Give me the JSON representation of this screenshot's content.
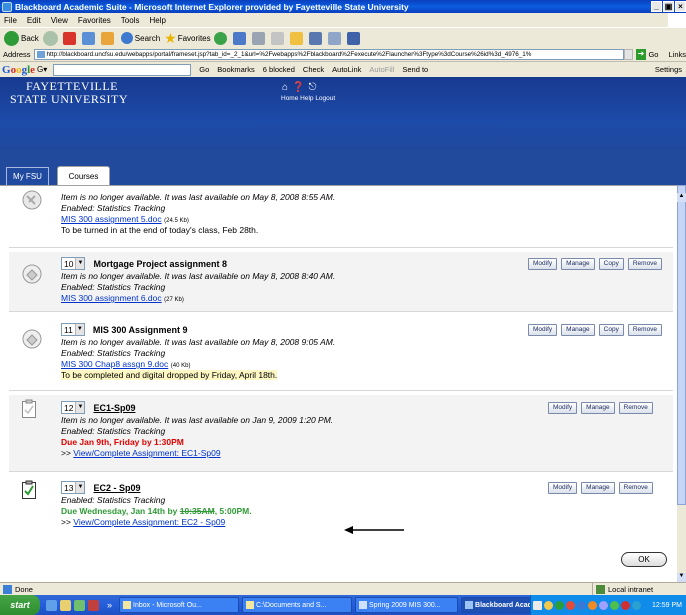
{
  "window": {
    "title": "Blackboard Academic Suite - Microsoft Internet Explorer provided by Fayetteville State University",
    "controls": [
      "_",
      "×"
    ]
  },
  "menu": [
    "File",
    "Edit",
    "View",
    "Favorites",
    "Tools",
    "Help"
  ],
  "toolbar": {
    "back": "Back",
    "search": "Search",
    "favorites": "Favorites"
  },
  "address": {
    "label": "Address",
    "url": "http://blackboard.uncfsu.edu/webapps/portal/frameset.jsp?tab_id=_2_1&url=%2Fwebapps%2Fblackboard%2Fexecute%2Flauncher%3Ftype%3dCourse%26id%3d_4976_1%",
    "go": "Go",
    "links": "Links"
  },
  "googlebar": {
    "go": "Go",
    "bookmarks": "Bookmarks",
    "blocked": "6 blocked",
    "check": "Check",
    "autolink": "AutoLink",
    "autofill": "AutoFill",
    "sendto": "Send to",
    "settings": "Settings"
  },
  "portal": {
    "university_line1": "Fayetteville",
    "university_line2": "State University",
    "nav_labels": "Home Help Logout",
    "tabs": {
      "myfsu": "My FSU",
      "courses": "Courses"
    }
  },
  "buttons": {
    "modify": "Modify",
    "manage": "Manage",
    "copy": "Copy",
    "remove": "Remove",
    "ok": "OK"
  },
  "items": [
    {
      "partial_title": "",
      "availability": "Item is no longer available. It was last available on May 8, 2008 8:55 AM.",
      "tracking": "Enabled: Statistics Tracking",
      "file": "MIS 300 assignment 5.doc",
      "size": "(24.5 Kb)",
      "note": "To be turned in at the end of today's class, Feb 28th."
    },
    {
      "number": "10",
      "title": "Mortgage Project assignment 8",
      "availability": "Item is no longer available. It was last available on May 8, 2008 8:40 AM.",
      "tracking": "Enabled: Statistics Tracking",
      "file": "MIS 300 assignment 6.doc",
      "size": "(27 Kb)"
    },
    {
      "number": "11",
      "title": "MIS 300 Assignment 9",
      "availability": "Item is no longer available. It was last available on May 8, 2008 9:05 AM.",
      "tracking": "Enabled: Statistics Tracking",
      "file": "MIS 300 Chap8 assgn 9.doc",
      "size": "(40 Kb)",
      "note": "To be completed and digital dropped by Friday, April 18th."
    },
    {
      "number": "12",
      "title": "EC1-Sp09",
      "availability": "Item is no longer available. It was last available on Jan 9, 2009 1:20 PM.",
      "tracking": "Enabled: Statistics Tracking",
      "due": "Due Jan 9th, Friday by 1:30PM",
      "link_prefix": ">> ",
      "link": "View/Complete Assignment: EC1-Sp09"
    },
    {
      "number": "13",
      "title": "EC2 - Sp09",
      "tracking": "Enabled: Statistics Tracking",
      "due_prefix": "Due Wednesday, Jan 14th by ",
      "due_struck": "10:35AM",
      "due_suffix": ", 5:00PM.",
      "link_prefix": ">> ",
      "link": "View/Complete Assignment: EC2 - Sp09"
    }
  ],
  "status": {
    "done": "Done",
    "zone": "Local intranet"
  },
  "taskbar": {
    "start": "start",
    "chevron": "»",
    "tasks": [
      {
        "label": "Inbox - Microsoft Ou..."
      },
      {
        "label": "C:\\Documents and S..."
      },
      {
        "label": "Spring 2009 MIS 300..."
      },
      {
        "label": "Blackboard Acade..."
      }
    ],
    "clock": "12:59 PM"
  }
}
